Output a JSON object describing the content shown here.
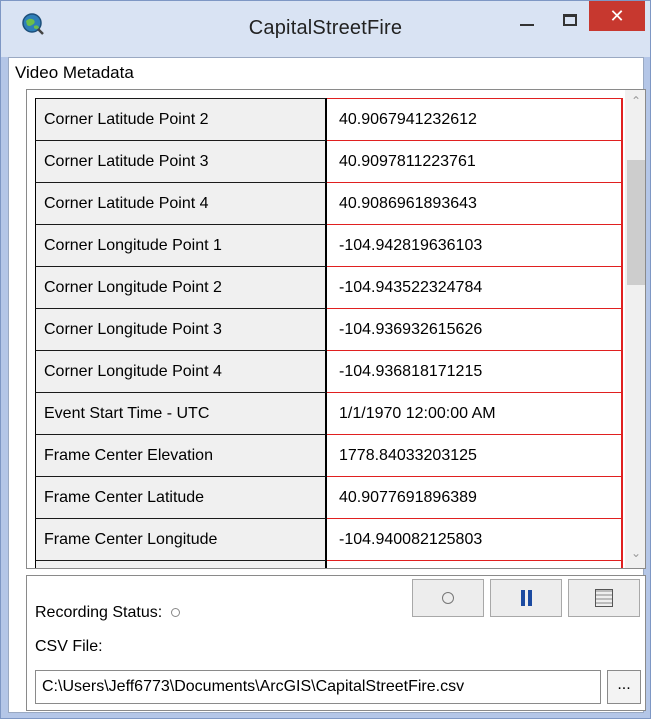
{
  "window": {
    "title": "CapitalStreetFire",
    "close_label": "✕"
  },
  "panel": {
    "title": "Video Metadata"
  },
  "metadata_rows": [
    {
      "key": "Corner Latitude Point 2",
      "value": "40.9067941232612"
    },
    {
      "key": "Corner Latitude Point 3",
      "value": "40.9097811223761"
    },
    {
      "key": "Corner Latitude Point 4",
      "value": "40.9086961893643"
    },
    {
      "key": "Corner Longitude Point 1",
      "value": "-104.942819636103"
    },
    {
      "key": "Corner Longitude Point 2",
      "value": "-104.943522324784"
    },
    {
      "key": "Corner Longitude Point 3",
      "value": "-104.936932615626"
    },
    {
      "key": "Corner Longitude Point 4",
      "value": "-104.936818171215"
    },
    {
      "key": "Event Start Time - UTC",
      "value": "1/1/1970 12:00:00 AM"
    },
    {
      "key": "Frame Center Elevation",
      "value": "1778.84033203125"
    },
    {
      "key": "Frame Center Latitude",
      "value": "40.9077691896389"
    },
    {
      "key": "Frame Center Longitude",
      "value": "-104.940082125803"
    }
  ],
  "recording": {
    "status_label": "Recording Status:",
    "csv_label": "CSV File:",
    "csv_path": "C:\\Users\\Jeff6773\\Documents\\ArcGIS\\CapitalStreetFire.csv",
    "browse_label": "..."
  },
  "icons": {
    "app": "globe-magnifier-icon",
    "record": "record-icon",
    "pause": "pause-icon",
    "stop": "stop-icon"
  },
  "colors": {
    "value_border": "#e02020",
    "pause_accent": "#1b4aa0",
    "close_button": "#c7382f"
  }
}
